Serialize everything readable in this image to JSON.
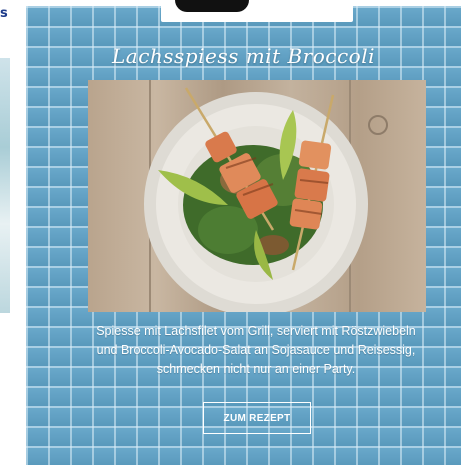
{
  "neighbor_card": {
    "title_fragment": "s"
  },
  "recipe_card": {
    "title": "Lachsspiess mit Broccoli",
    "description_lines": [
      "Spiesse mit Lachsfilet vom Grill, serviert mit Röstzwiebeln",
      "und Broccoli-Avocado-Salat an Sojasauce und Reisessig,",
      "schmecken nicht nur an einer Party."
    ],
    "cta_label": "ZUM REZEPT",
    "colors": {
      "tile_blue": "#5fa3c8",
      "text": "#ffffff"
    }
  }
}
